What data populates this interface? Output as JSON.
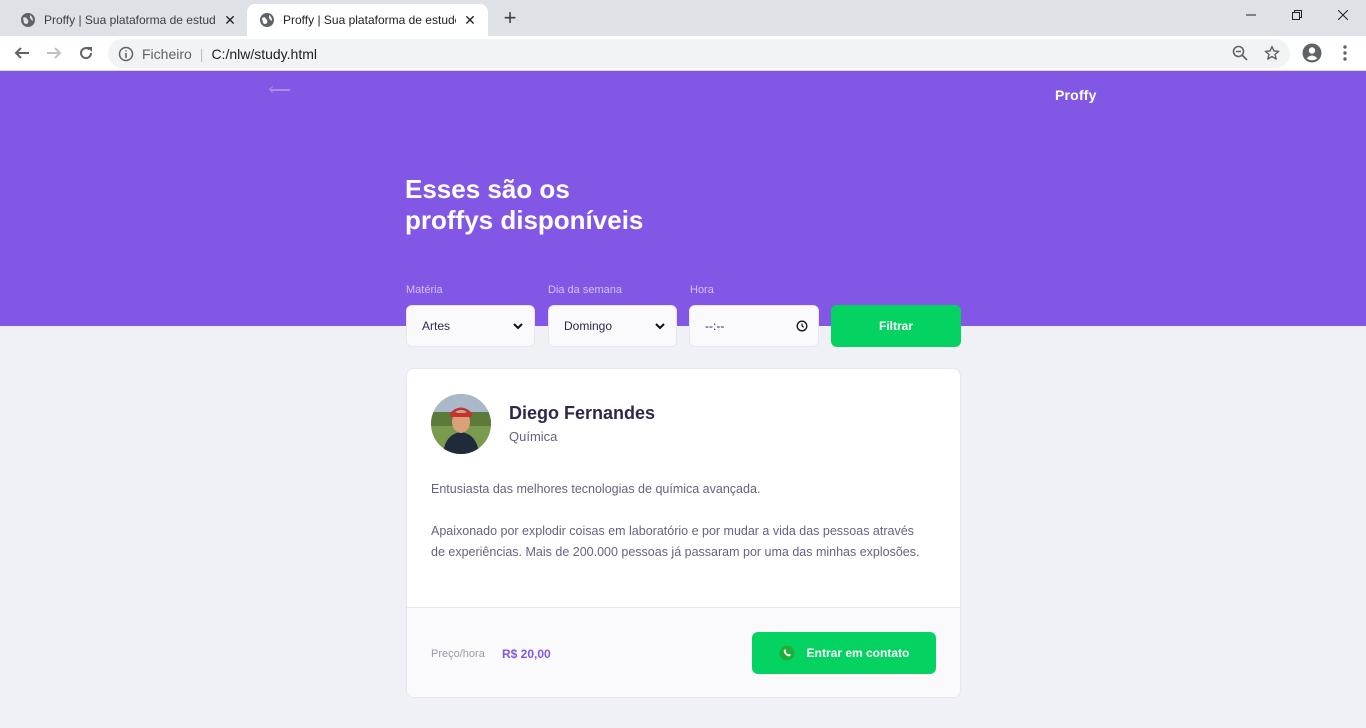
{
  "browser": {
    "tabs": [
      {
        "title": "Proffy | Sua plataforma de estudos",
        "active": false
      },
      {
        "title": "Proffy | Sua plataforma de estudos",
        "active": true
      }
    ],
    "address": {
      "scheme": "Ficheiro",
      "url": "C:/nlw/study.html"
    },
    "icons": [
      "globe-icon",
      "close-icon",
      "plus-icon",
      "back-arrow-icon",
      "forward-arrow-icon",
      "reload-icon",
      "info-icon",
      "zoom-icon",
      "star-icon",
      "account-icon",
      "menu-dots-icon"
    ]
  },
  "header": {
    "brand": "Proffy",
    "title_line1": "Esses são os",
    "title_line2": "proffys disponíveis"
  },
  "filters": {
    "subject": {
      "label": "Matéria",
      "value": "Artes"
    },
    "weekday": {
      "label": "Dia da semana",
      "value": "Domingo"
    },
    "time": {
      "label": "Hora",
      "value": "--:--"
    },
    "submit_label": "Filtrar"
  },
  "teacher": {
    "name": "Diego Fernandes",
    "subject": "Química",
    "bio_1": "Entusiasta das melhores tecnologias de química avançada.",
    "bio_2": "Apaixonado por explodir coisas em laboratório e por mudar a vida das pessoas através de experiências. Mais de 200.000 pessoas já passaram por uma das minhas explosões.",
    "price_label": "Preço/hora",
    "price_value": "R$ 20,00",
    "contact_label": "Entrar em contato"
  },
  "colors": {
    "primary": "#8257E5",
    "secondary": "#04D361",
    "background": "#F0F0F7",
    "title": "#32264D",
    "text": "#6A6180"
  }
}
